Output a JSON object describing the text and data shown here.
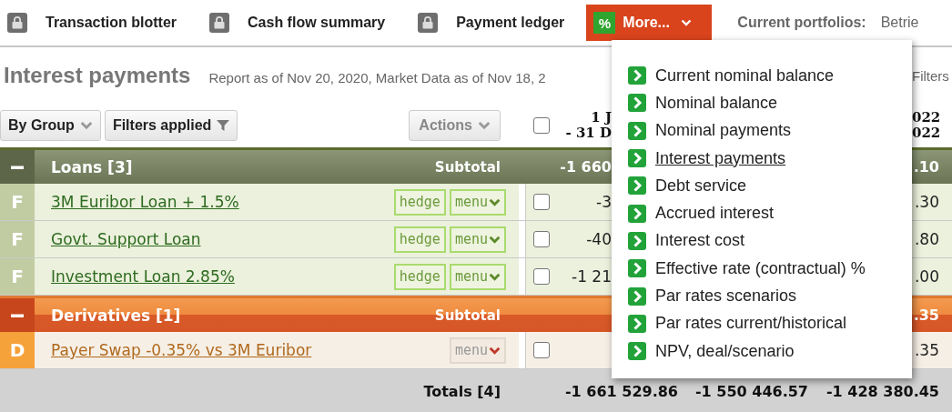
{
  "nav": {
    "items": [
      {
        "label": "Transaction blotter"
      },
      {
        "label": "Cash flow summary"
      },
      {
        "label": "Payment ledger"
      }
    ],
    "more": {
      "icon_text": "%",
      "label": "More...",
      "expanded": true
    },
    "portfolios_label": "Current portfolios:",
    "portfolios_value": "Betrie"
  },
  "report": {
    "title": "Interest payments",
    "subtitle": "Report as of Nov 20, 2020, Market Data as of Nov 18, 2",
    "filters": "Filters"
  },
  "toolbar": {
    "group_by": "By Group",
    "filters": "Filters applied",
    "actions": "Actions"
  },
  "columns": {
    "select_all_checked": false,
    "column_1": [
      "1 J",
      "- 31 D"
    ],
    "column_3": [
      "022",
      "022"
    ]
  },
  "groups": [
    {
      "kind": "loans",
      "expanded": true,
      "title": "Loans [3]",
      "subtotal_label": "Subtotal",
      "subtotal_column_1": "-1 660",
      "subtotal_column_3": ".10",
      "rows": [
        {
          "marker": "F",
          "name": "3M Euribor Loan + 1.5%",
          "hedge": "hedge",
          "menu": "menu",
          "checked": false,
          "column_1": "-3",
          "column_3": ".30"
        },
        {
          "marker": "F",
          "name": "Govt. Support Loan",
          "hedge": "hedge",
          "menu": "menu",
          "checked": false,
          "column_1": "-40",
          "column_3": ".80"
        },
        {
          "marker": "F",
          "name": "Investment Loan 2.85%",
          "hedge": "hedge",
          "menu": "menu",
          "checked": false,
          "column_1": "-1 21",
          "column_3": ".00"
        }
      ]
    },
    {
      "kind": "derivatives",
      "expanded": true,
      "title": "Derivatives [1]",
      "subtotal_label": "Subtotal",
      "subtotal_column_3": ".35",
      "rows": [
        {
          "marker": "D",
          "name": "Payer Swap -0.35% vs 3M Euribor",
          "menu": "menu",
          "checked": false,
          "column_3": ".35"
        }
      ]
    }
  ],
  "totals": {
    "label": "Totals [4]",
    "values": [
      "-1 661 529.86",
      "-1 550 446.57",
      "-1 428 380.45"
    ]
  },
  "more_menu": {
    "items": [
      {
        "label": "Current nominal balance",
        "selected": false
      },
      {
        "label": "Nominal balance",
        "selected": false
      },
      {
        "label": "Nominal payments",
        "selected": false
      },
      {
        "label": "Interest payments",
        "selected": true
      },
      {
        "label": "Debt service",
        "selected": false
      },
      {
        "label": "Accrued interest",
        "selected": false
      },
      {
        "label": "Interest cost",
        "selected": false
      },
      {
        "label": "Effective rate (contractual) %",
        "selected": false
      },
      {
        "label": "Par rates scenarios",
        "selected": false
      },
      {
        "label": "Par rates current/historical",
        "selected": false
      },
      {
        "label": "NPV, deal/scenario",
        "selected": false
      }
    ]
  }
}
